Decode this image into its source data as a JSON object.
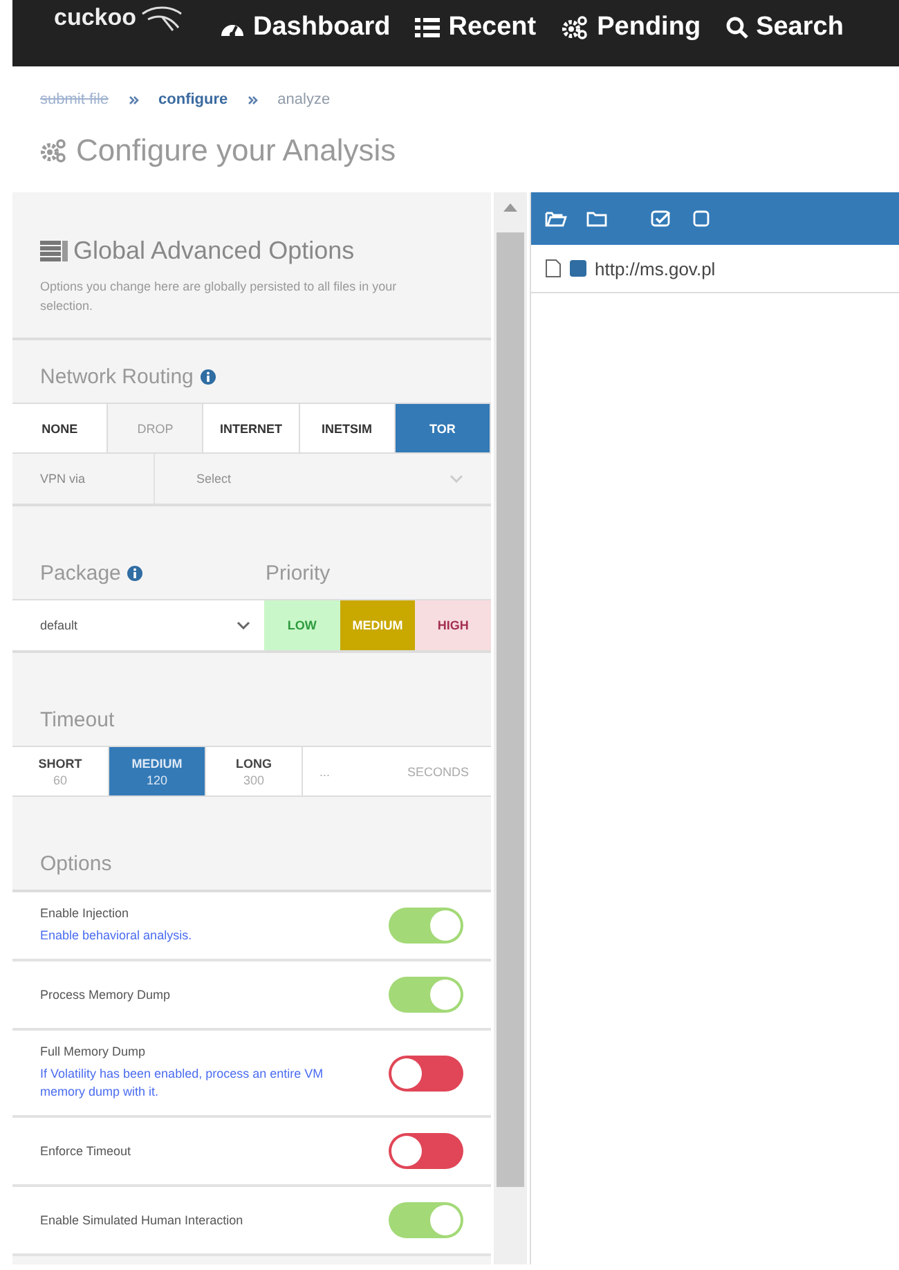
{
  "nav": {
    "logo": "cuckoo",
    "items": [
      {
        "kind": "dashboard",
        "label": "Dashboard"
      },
      {
        "kind": "recent",
        "label": "Recent"
      },
      {
        "kind": "pending",
        "label": "Pending"
      },
      {
        "kind": "search",
        "label": "Search"
      }
    ]
  },
  "breadcrumb": [
    {
      "label": "submit file",
      "done": true,
      "selected": false
    },
    {
      "label": "configure",
      "done": false,
      "selected": true
    },
    {
      "label": "analyze",
      "done": false,
      "selected": false
    }
  ],
  "page_title": "Configure your Analysis",
  "options_panel": {
    "title": "Global Advanced Options",
    "description": "Options you change here are globally persisted to all files in your selection.",
    "network_routing": {
      "label": "Network Routing",
      "choices": [
        {
          "label": "NONE",
          "selected": false,
          "disabled": false
        },
        {
          "label": "DROP",
          "selected": false,
          "disabled": true
        },
        {
          "label": "INTERNET",
          "selected": false,
          "disabled": false
        },
        {
          "label": "INETSIM",
          "selected": false,
          "disabled": false
        },
        {
          "label": "TOR",
          "selected": true,
          "disabled": false
        }
      ],
      "vpn": {
        "label": "VPN via",
        "placeholder": "Select"
      }
    },
    "package": {
      "label": "Package",
      "value": "default"
    },
    "priority": {
      "label": "Priority",
      "choices": [
        {
          "label": "LOW",
          "selected": false,
          "color": "#c9f7c9"
        },
        {
          "label": "MEDIUM",
          "selected": true,
          "color": "#c9a800"
        },
        {
          "label": "HIGH",
          "selected": false,
          "color": "#f7dce0"
        }
      ]
    },
    "timeout": {
      "label": "Timeout",
      "choices": [
        {
          "label": "SHORT",
          "value": "60",
          "selected": false
        },
        {
          "label": "MEDIUM",
          "value": "120",
          "selected": true
        },
        {
          "label": "LONG",
          "value": "300",
          "selected": false
        }
      ],
      "custom_placeholder": "...",
      "unit": "SECONDS"
    },
    "options": {
      "label": "Options",
      "items": [
        {
          "label": "Enable Injection",
          "hint": "Enable behavioral analysis.",
          "on": true
        },
        {
          "label": "Process Memory Dump",
          "on": true
        },
        {
          "label": "Full Memory Dump",
          "hint": "If Volatility has been enabled, process an entire VM memory dump with it.",
          "on": false
        },
        {
          "label": "Enforce Timeout",
          "on": false
        },
        {
          "label": "Enable Simulated Human Interaction",
          "on": true
        }
      ]
    }
  },
  "file_tree": {
    "items": [
      {
        "label": "http://ms.gov.pl",
        "checked": true
      }
    ]
  }
}
